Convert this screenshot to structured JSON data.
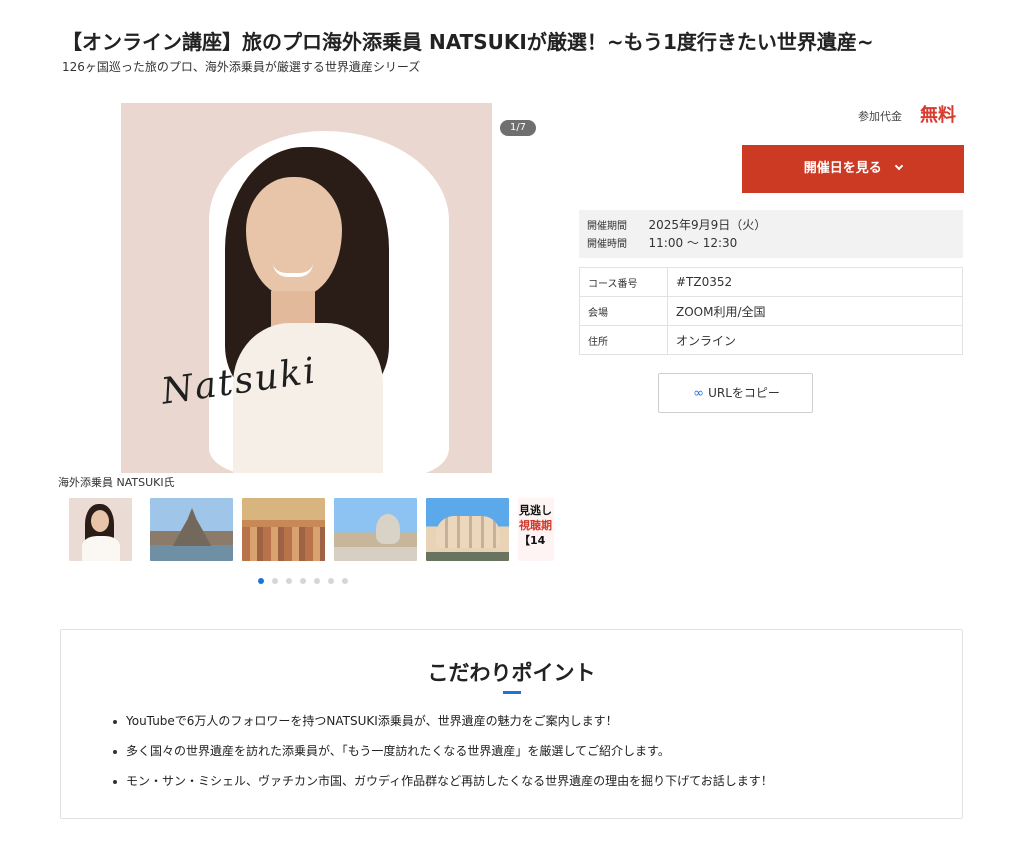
{
  "header": {
    "title": "【オンライン講座】旅のプロ海外添乗員 NATSUKIが厳選！~もう1度行きたい世界遺産~",
    "subtitle": "126ヶ国巡った旅のプロ、海外添乗員が厳選する世界遺産シリーズ"
  },
  "gallery": {
    "counter": "1/7",
    "caption": "海外添乗員 NATSUKI氏",
    "signature": "Natsuki",
    "active_index": 1,
    "total": 7,
    "thumbnails": [
      "person-photo-icon",
      "mont-saint-michel-photo",
      "roman-rooftops-photo",
      "vatican-city-photo",
      "gaudi-building-photo",
      "promo-banner"
    ],
    "promo_text_1": "見逃し",
    "promo_text_2": "視聴期",
    "promo_text_3": "【14"
  },
  "pricing": {
    "label": "参加代金",
    "value": "無料",
    "button_label": "開催日を見る",
    "button_icon": "chevron-down-icon",
    "accent_color": "#cc3a24"
  },
  "schedule": {
    "period_label": "開催期間",
    "period_value": "2025年9月9日（火）",
    "time_label": "開催時間",
    "time_value": "11:00 〜 12:30"
  },
  "details": {
    "rows": [
      {
        "label": "コース番号",
        "value": "#TZ0352"
      },
      {
        "label": "会場",
        "value": "ZOOM利用/全国"
      },
      {
        "label": "住所",
        "value": "オンライン"
      }
    ]
  },
  "copy_url": {
    "icon": "link-icon",
    "label": "URLをコピー"
  },
  "features": {
    "title": "こだわりポイント",
    "items": [
      "YouTubeで6万人のフォロワーを持つNATSUKI添乗員が、世界遺産の魅力をご案内します！",
      "多く国々の世界遺産を訪れた添乗員が、「もう一度訪れたくなる世界遺産」を厳選してご紹介します。",
      "モン・サン・ミシェル、ヴァチカン市国、ガウディ作品群など再訪したくなる世界遺産の理由を掘り下げてお話します！"
    ],
    "accent_color": "#1f73d8"
  }
}
